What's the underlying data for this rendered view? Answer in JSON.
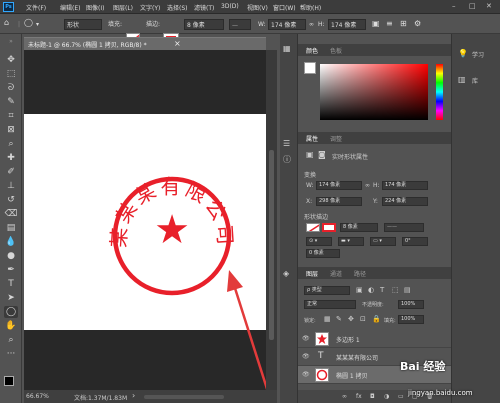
{
  "menubar": {
    "logo": "Ps",
    "items": [
      "文件(F)",
      "编辑(E)",
      "图像(I)",
      "图层(L)",
      "文字(Y)",
      "选择(S)",
      "滤镜(T)",
      "3D(D)",
      "视图(V)",
      "窗口(W)",
      "帮助(H)"
    ],
    "minimize": "–",
    "maximize": "□",
    "close": "✕"
  },
  "options": {
    "shape_mode": "形状",
    "fill_label": "填充:",
    "stroke_label": "描边:",
    "stroke_width": "8 像素",
    "w_label": "W:",
    "w_value": "174 像素",
    "link": "∞",
    "h_label": "H:",
    "h_value": "174 像素"
  },
  "document": {
    "tab_title": "未标题-1 @ 66.7% (椭圆 1 拷贝, RGB/8) *",
    "close": "×"
  },
  "stamp": {
    "text": "某某某有限公司",
    "star": "★",
    "color": "#e8202a"
  },
  "status": {
    "zoom": "66.67%",
    "doc_info": "文档:1.37M/1.83M",
    "arrow": "›"
  },
  "color_panel": {
    "tabs": [
      "颜色",
      "色板"
    ]
  },
  "properties": {
    "tabs": [
      "属性",
      "调整"
    ],
    "header": "实时形状属性",
    "transform_label": "变换",
    "w_label": "W:",
    "w_value": "174 像素",
    "link": "∞",
    "h_label": "H:",
    "h_value": "174 像素",
    "x_label": "X:",
    "x_value": "298 像素",
    "y_label": "Y:",
    "y_value": "224 像素",
    "section_label": "形状描边",
    "stroke_width": "8 像素",
    "rotation": "0°",
    "value_a": "0 像素"
  },
  "layers": {
    "tabs": [
      "图层",
      "通道",
      "路径"
    ],
    "kind": "ρ 类型",
    "blend_mode": "正常",
    "opacity_label": "不透明度:",
    "opacity": "100%",
    "lock_label": "锁定:",
    "fill_label": "填充:",
    "fill": "100%",
    "items": [
      {
        "name": "多边形 1",
        "kind": "shape"
      },
      {
        "name": "某某某有限公司",
        "kind": "text"
      },
      {
        "name": "椭圆 1 拷贝",
        "kind": "shape"
      }
    ],
    "footer_icons": [
      "link-icon",
      "fx-icon",
      "mask-icon",
      "adjustment-icon",
      "folder-icon",
      "new-layer-icon",
      "trash-icon"
    ],
    "footer_glyphs": [
      "∞",
      "fx",
      "◘",
      "◑",
      "▭",
      "▢",
      "🗑"
    ]
  },
  "learn_panel": {
    "items": [
      {
        "icon": "learn-icon",
        "label": "学习"
      },
      {
        "icon": "library-icon",
        "label": "库"
      }
    ]
  },
  "watermark": {
    "site": "jingyan.baidu.com",
    "brand": "Bai 经验"
  },
  "annotation": {
    "color": "#e23b3b"
  }
}
